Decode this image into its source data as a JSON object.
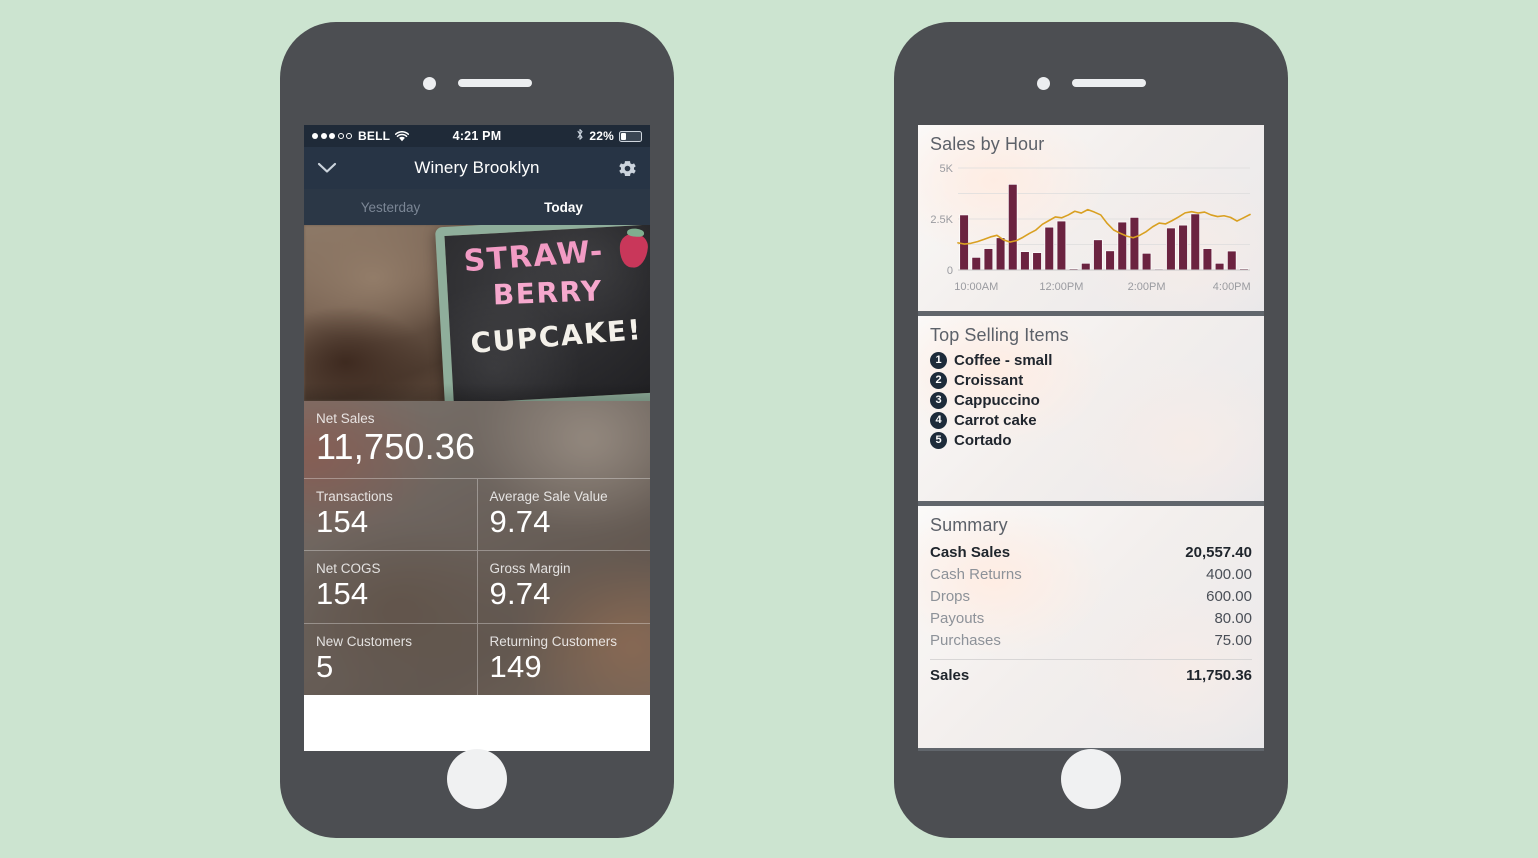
{
  "theme": {
    "background": "#cce4d0",
    "bezel": "#4c4e52",
    "navbar": "#273445",
    "statusbar": "#1f2a38",
    "bar_color": "#6b2340",
    "line_color": "#d9a021",
    "card_bg": "#f7f5f4"
  },
  "left_phone": {
    "status_bar": {
      "carrier": "BELL",
      "signal_filled": 3,
      "signal_total": 5,
      "wifi_icon": "wifi-icon",
      "time": "4:21 PM",
      "bluetooth_icon": "bluetooth-icon",
      "battery_percent": "22%",
      "battery_level": 22
    },
    "nav": {
      "back_icon": "chevron-down-icon",
      "title": "Winery Brooklyn",
      "settings_icon": "gear-icon"
    },
    "tabs": [
      {
        "label": "Yesterday",
        "active": false
      },
      {
        "label": "Today",
        "active": true
      }
    ],
    "hero": {
      "alt": "Strawberry cupcake chalkboard sign",
      "chalk_line_1": "STRAW-",
      "chalk_line_2": "BERRY",
      "chalk_line_3": "CUPCAKE!"
    },
    "metrics": {
      "net_sales": {
        "label": "Net Sales",
        "value": "11,750.36"
      },
      "transactions": {
        "label": "Transactions",
        "value": "154"
      },
      "average_sale_value": {
        "label": "Average Sale Value",
        "value": "9.74"
      },
      "net_cogs": {
        "label": "Net COGS",
        "value": "154"
      },
      "gross_margin": {
        "label": "Gross Margin",
        "value": "9.74"
      },
      "new_customers": {
        "label": "New Customers",
        "value": "5"
      },
      "returning_customers": {
        "label": "Returning Customers",
        "value": "149"
      }
    }
  },
  "right_phone": {
    "chart_card": {
      "title": "Sales by Hour"
    },
    "top_selling": {
      "title": "Top Selling Items",
      "items": [
        {
          "rank": "1",
          "name": "Coffee - small"
        },
        {
          "rank": "2",
          "name": "Croissant"
        },
        {
          "rank": "3",
          "name": "Cappuccino"
        },
        {
          "rank": "4",
          "name": "Carrot cake"
        },
        {
          "rank": "5",
          "name": "Cortado"
        }
      ]
    },
    "summary": {
      "title": "Summary",
      "rows": [
        {
          "label": "Cash Sales",
          "value": "20,557.40",
          "strong": true
        },
        {
          "label": "Cash Returns",
          "value": "400.00",
          "strong": false
        },
        {
          "label": "Drops",
          "value": "600.00",
          "strong": false
        },
        {
          "label": "Payouts",
          "value": "80.00",
          "strong": false
        },
        {
          "label": "Purchases",
          "value": "75.00",
          "strong": false
        }
      ],
      "total": {
        "label": "Sales",
        "value": "11,750.36"
      }
    }
  },
  "chart_data": {
    "type": "bar",
    "title": "Sales by Hour",
    "xlabel": "",
    "ylabel": "",
    "ylim": [
      0,
      5000
    ],
    "ytick_labels": [
      "0",
      "2.5K",
      "5K"
    ],
    "ytick_values": [
      0,
      2500,
      5000
    ],
    "gridlines": [
      0,
      1250,
      2500,
      3750,
      5000
    ],
    "grid": true,
    "legend": "none",
    "xtick_labels": [
      "10:00AM",
      "12:00PM",
      "2:00PM",
      "4:00PM"
    ],
    "xtick_positions": [
      1.5,
      8.5,
      15.5,
      22.5
    ],
    "bar_color": "#6b2340",
    "line_color": "#d9a021",
    "series": [
      {
        "name": "Sales",
        "type": "bar",
        "values": [
          2700,
          620,
          1050,
          1580,
          4200,
          900,
          850,
          2100,
          2400,
          60,
          330,
          1480,
          940,
          2350,
          2580,
          820,
          50,
          2060,
          2200,
          2750,
          1050,
          330,
          930,
          60
        ]
      },
      {
        "name": "Trend",
        "type": "line",
        "values": [
          1330,
          1270,
          1310,
          1390,
          1500,
          1620,
          1700,
          1480,
          1370,
          1440,
          1600,
          1790,
          1960,
          2240,
          2420,
          2600,
          2560,
          2700,
          2880,
          2790,
          2960,
          2840,
          2700,
          2280,
          1960,
          1800,
          1660,
          1580,
          1700,
          1880,
          2120,
          2300,
          2260,
          2420,
          2600,
          2800,
          2860,
          2790,
          2840,
          2700,
          2620,
          2660,
          2580,
          2400,
          2560,
          2720
        ]
      }
    ]
  }
}
